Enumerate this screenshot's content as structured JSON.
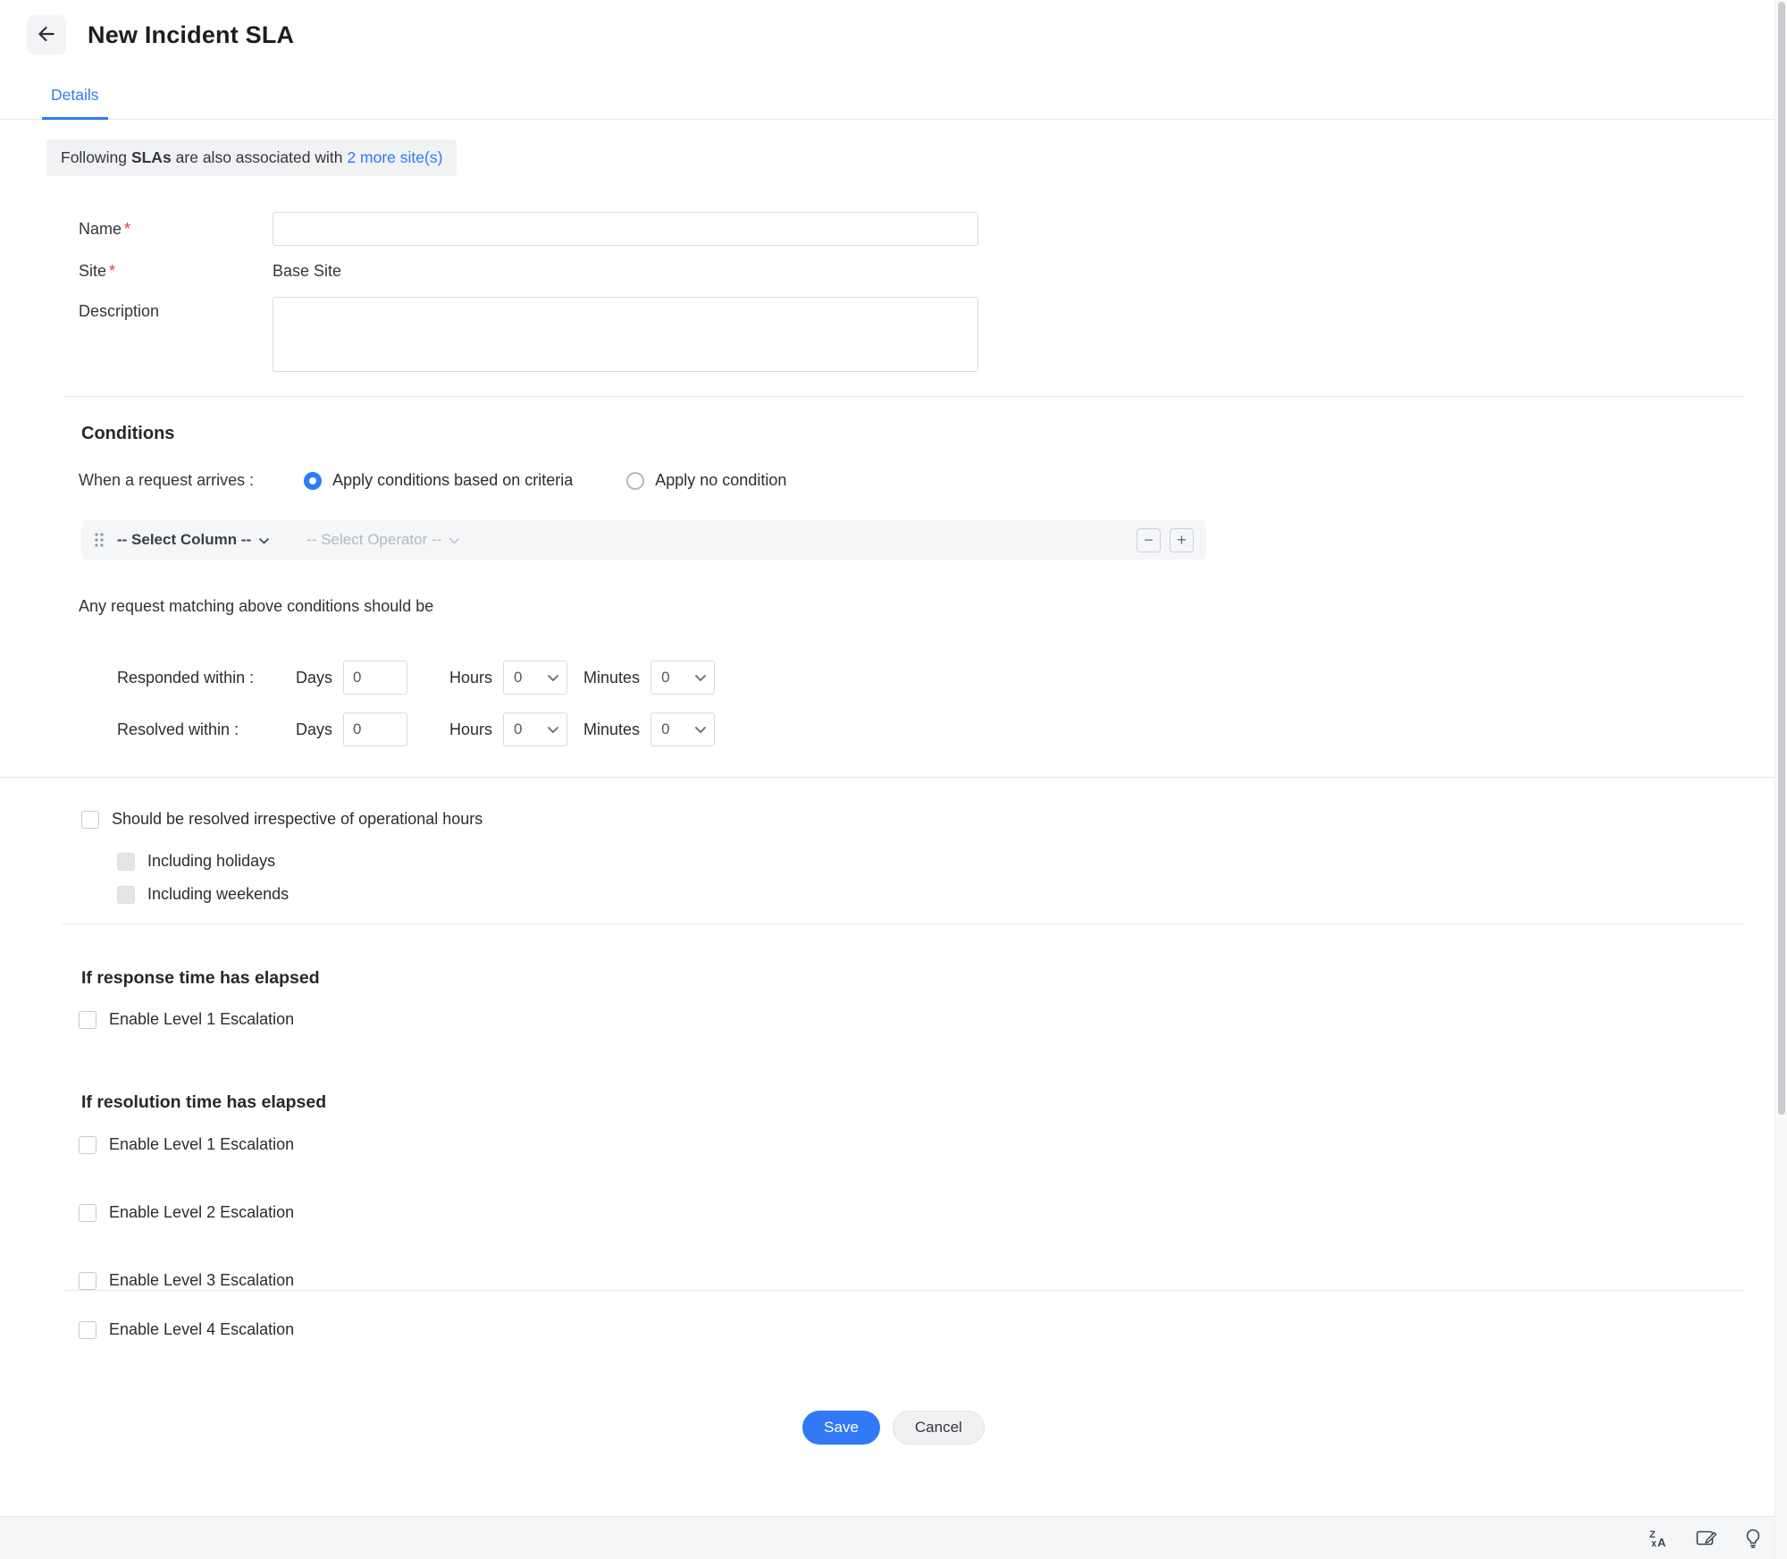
{
  "header": {
    "title": "New Incident SLA"
  },
  "tabs": {
    "details_label": "Details"
  },
  "banner": {
    "text_before": "Following",
    "bold": "SLAs",
    "text_middle": "are also associated with",
    "link": "2 more site(s)"
  },
  "form": {
    "name_label": "Name",
    "site_label": "Site",
    "site_value": "Base Site",
    "description_label": "Description",
    "required_marker": "*",
    "name_value": "",
    "description_value": ""
  },
  "conditions": {
    "heading": "Conditions",
    "arrives_label": "When a request arrives :",
    "radio_criteria_label": "Apply conditions based on criteria",
    "radio_none_label": "Apply no condition",
    "select_column_placeholder": "-- Select Column --",
    "select_operator_placeholder": "-- Select Operator --",
    "minus_label": "−",
    "plus_label": "+",
    "matching_text": "Any request matching above conditions should be",
    "responded_label": "Responded within :",
    "resolved_label": "Resolved within :",
    "days_label": "Days",
    "hours_label": "Hours",
    "minutes_label": "Minutes",
    "responded": {
      "days": "0",
      "hours": "0",
      "minutes": "0"
    },
    "resolved": {
      "days": "0",
      "hours": "0",
      "minutes": "0"
    }
  },
  "operational": {
    "main_label": "Should be resolved irrespective of operational hours",
    "holidays_label": "Including holidays",
    "weekends_label": "Including weekends"
  },
  "response_section": {
    "heading": "If response time has elapsed",
    "level1_label": "Enable Level 1 Escalation"
  },
  "resolution_section": {
    "heading": "If resolution time has elapsed",
    "levels": [
      "Enable Level 1 Escalation",
      "Enable Level 2 Escalation",
      "Enable Level 3 Escalation",
      "Enable Level 4 Escalation"
    ]
  },
  "actions": {
    "save_label": "Save",
    "cancel_label": "Cancel"
  },
  "footer_icons": [
    "translate-icon",
    "feedback-icon",
    "lightbulb-icon"
  ],
  "colors": {
    "primary": "#3179f5",
    "link": "#2b7cf6",
    "required": "#e03c32"
  }
}
